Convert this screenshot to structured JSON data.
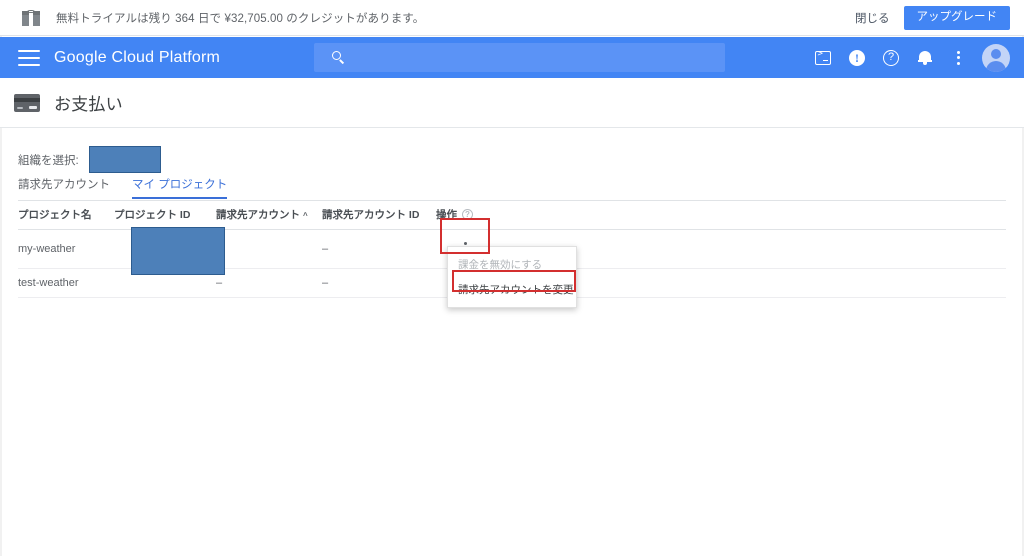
{
  "banner": {
    "icon": "gift-icon",
    "message": "無料トライアルは残り 364 日で ¥32,705.00 のクレジットがあります。",
    "trial_days_remaining": "364",
    "credit_amount": "¥32,705.00",
    "close_label": "閉じる",
    "upgrade_label": "アップグレード"
  },
  "topbar": {
    "menu_icon": "hamburger-icon",
    "brand": "Google Cloud Platform",
    "search": {
      "icon": "search-icon",
      "value": "",
      "placeholder": ""
    },
    "icons": [
      {
        "name": "cloud-shell-icon",
        "glyph": ">_"
      },
      {
        "name": "feedback-icon",
        "glyph": "!"
      },
      {
        "name": "help-icon",
        "glyph": "?"
      },
      {
        "name": "notifications-bell-icon",
        "glyph": "bell"
      },
      {
        "name": "more-options-icon",
        "glyph": "⋮"
      },
      {
        "name": "account-avatar",
        "glyph": "person"
      }
    ]
  },
  "page": {
    "icon": "credit-card-icon",
    "title": "お支払い"
  },
  "org_selector": {
    "label": "組織を選択:",
    "value": ""
  },
  "tabs": [
    {
      "label": "請求先アカウント",
      "active": false
    },
    {
      "label": "マイ プロジェクト",
      "active": true
    }
  ],
  "table": {
    "columns": [
      {
        "label": "プロジェクト名",
        "sort": ""
      },
      {
        "label": "プロジェクト ID",
        "sort": ""
      },
      {
        "label": "請求先アカウント",
        "sort": "asc",
        "sort_glyph": "^"
      },
      {
        "label": "請求先アカウント ID",
        "sort": ""
      },
      {
        "label": "操作",
        "help": "?"
      }
    ],
    "rows": [
      {
        "project_name": "my-weather",
        "project_id": "",
        "billing_account": "–",
        "billing_account_id": "–",
        "ops": "⋮"
      },
      {
        "project_name": "test-weather",
        "project_id": "",
        "billing_account": "–",
        "billing_account_id": "–",
        "ops": "⋮"
      }
    ]
  },
  "context_menu": {
    "items": [
      {
        "label": "課金を無効にする",
        "disabled": true,
        "highlighted": false
      },
      {
        "label": "請求先アカウントを変更",
        "disabled": false,
        "highlighted": true
      }
    ]
  },
  "colors": {
    "brand_blue": "#4285f4",
    "search_blue": "#5b93f6",
    "accent_tab": "#3a6fd8",
    "highlight_red": "#d32f2f",
    "redaction_blue": "#4d80b9",
    "text_gray": "#5f6368"
  }
}
